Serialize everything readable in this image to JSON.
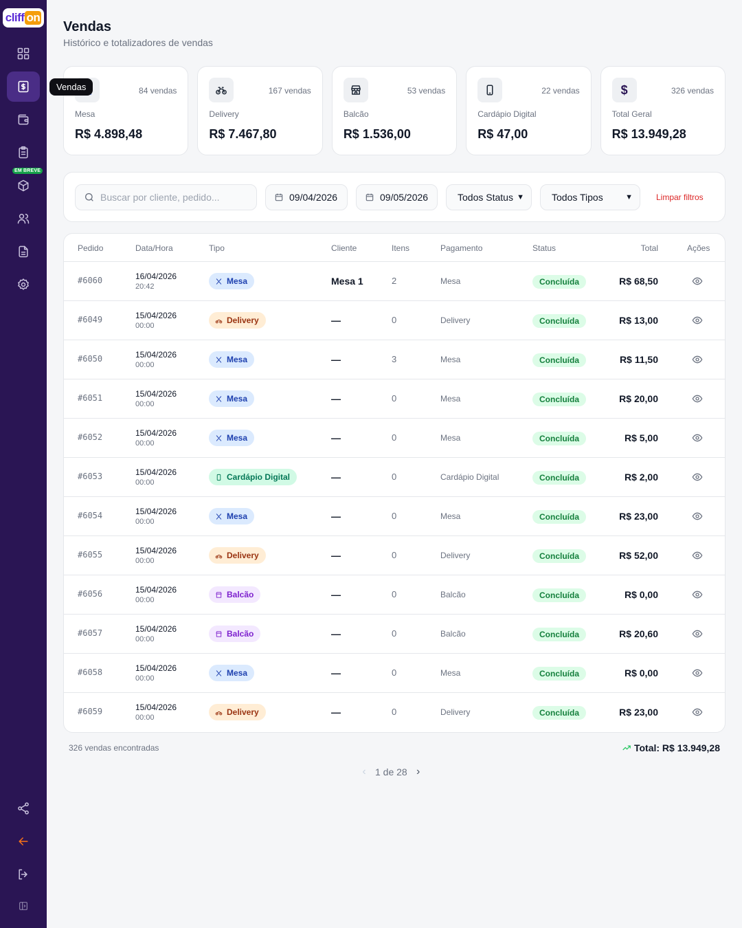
{
  "app": {
    "logo_part1": "cliff",
    "logo_part2": "on",
    "soon_badge": "EM BREVE",
    "tooltip": "Vendas"
  },
  "sidebar": {
    "items": [
      {
        "icon": "dashboard-icon"
      },
      {
        "icon": "sales-icon",
        "active": true
      },
      {
        "icon": "wallet-icon"
      },
      {
        "icon": "clipboard-icon"
      },
      {
        "icon": "box-icon"
      },
      {
        "icon": "users-icon"
      },
      {
        "icon": "document-icon"
      },
      {
        "icon": "gear-icon"
      }
    ],
    "bottom": [
      {
        "icon": "share-icon"
      },
      {
        "icon": "arrow-left-icon",
        "color": "#f97316"
      },
      {
        "icon": "logout-icon"
      },
      {
        "icon": "collapse-sidebar-icon"
      }
    ],
    "colors": {
      "background": "#2a1554",
      "active": "#4a2d86"
    }
  },
  "header": {
    "title": "Vendas",
    "subtitle": "Histórico e totalizadores de vendas"
  },
  "cards": [
    {
      "label": "Mesa",
      "count": "84 vendas",
      "value": "R$ 4.898,48",
      "icon": "utensils-icon"
    },
    {
      "label": "Delivery",
      "count": "167 vendas",
      "value": "R$ 7.467,80",
      "icon": "bike-icon"
    },
    {
      "label": "Balcão",
      "count": "53 vendas",
      "value": "R$ 1.536,00",
      "icon": "store-icon"
    },
    {
      "label": "Cardápio Digital",
      "count": "22 vendas",
      "value": "R$ 47,00",
      "icon": "smartphone-icon"
    },
    {
      "label": "Total Geral",
      "count": "326 vendas",
      "value": "R$ 13.949,28",
      "icon": "dollar-icon"
    }
  ],
  "filters": {
    "search_placeholder": "Buscar por cliente, pedido...",
    "date_from": "09/04/2026",
    "date_to": "09/05/2026",
    "status": "Todos Status",
    "type": "Todos Tipos",
    "clear": "Limpar filtros"
  },
  "table": {
    "headers": {
      "pedido": "Pedido",
      "data": "Data/Hora",
      "tipo": "Tipo",
      "cliente": "Cliente",
      "itens": "Itens",
      "pagamento": "Pagamento",
      "status": "Status",
      "total": "Total",
      "acoes": "Ações"
    },
    "rows": [
      {
        "id": "#6060",
        "date": "16/04/2026",
        "time": "20:42",
        "type": "Mesa",
        "type_key": "mesa",
        "client": "Mesa 1",
        "items": "2",
        "payment": "Mesa",
        "status": "Concluída",
        "total": "R$ 68,50"
      },
      {
        "id": "#6049",
        "date": "15/04/2026",
        "time": "00:00",
        "type": "Delivery",
        "type_key": "delivery",
        "client": "—",
        "items": "0",
        "payment": "Delivery",
        "status": "Concluída",
        "total": "R$ 13,00"
      },
      {
        "id": "#6050",
        "date": "15/04/2026",
        "time": "00:00",
        "type": "Mesa",
        "type_key": "mesa",
        "client": "—",
        "items": "3",
        "payment": "Mesa",
        "status": "Concluída",
        "total": "R$ 11,50"
      },
      {
        "id": "#6051",
        "date": "15/04/2026",
        "time": "00:00",
        "type": "Mesa",
        "type_key": "mesa",
        "client": "—",
        "items": "0",
        "payment": "Mesa",
        "status": "Concluída",
        "total": "R$ 20,00"
      },
      {
        "id": "#6052",
        "date": "15/04/2026",
        "time": "00:00",
        "type": "Mesa",
        "type_key": "mesa",
        "client": "—",
        "items": "0",
        "payment": "Mesa",
        "status": "Concluída",
        "total": "R$ 5,00"
      },
      {
        "id": "#6053",
        "date": "15/04/2026",
        "time": "00:00",
        "type": "Cardápio Digital",
        "type_key": "cardapio",
        "client": "—",
        "items": "0",
        "payment": "Cardápio Digital",
        "status": "Concluída",
        "total": "R$ 2,00"
      },
      {
        "id": "#6054",
        "date": "15/04/2026",
        "time": "00:00",
        "type": "Mesa",
        "type_key": "mesa",
        "client": "—",
        "items": "0",
        "payment": "Mesa",
        "status": "Concluída",
        "total": "R$ 23,00"
      },
      {
        "id": "#6055",
        "date": "15/04/2026",
        "time": "00:00",
        "type": "Delivery",
        "type_key": "delivery",
        "client": "—",
        "items": "0",
        "payment": "Delivery",
        "status": "Concluída",
        "total": "R$ 52,00"
      },
      {
        "id": "#6056",
        "date": "15/04/2026",
        "time": "00:00",
        "type": "Balcão",
        "type_key": "balcao",
        "client": "—",
        "items": "0",
        "payment": "Balcão",
        "status": "Concluída",
        "total": "R$ 0,00"
      },
      {
        "id": "#6057",
        "date": "15/04/2026",
        "time": "00:00",
        "type": "Balcão",
        "type_key": "balcao",
        "client": "—",
        "items": "0",
        "payment": "Balcão",
        "status": "Concluída",
        "total": "R$ 20,60"
      },
      {
        "id": "#6058",
        "date": "15/04/2026",
        "time": "00:00",
        "type": "Mesa",
        "type_key": "mesa",
        "client": "—",
        "items": "0",
        "payment": "Mesa",
        "status": "Concluída",
        "total": "R$ 0,00"
      },
      {
        "id": "#6059",
        "date": "15/04/2026",
        "time": "00:00",
        "type": "Delivery",
        "type_key": "delivery",
        "client": "—",
        "items": "0",
        "payment": "Delivery",
        "status": "Concluída",
        "total": "R$ 23,00"
      }
    ]
  },
  "footer": {
    "found": "326 vendas encontradas",
    "total": "Total: R$ 13.949,28",
    "page": "1 de 28"
  }
}
